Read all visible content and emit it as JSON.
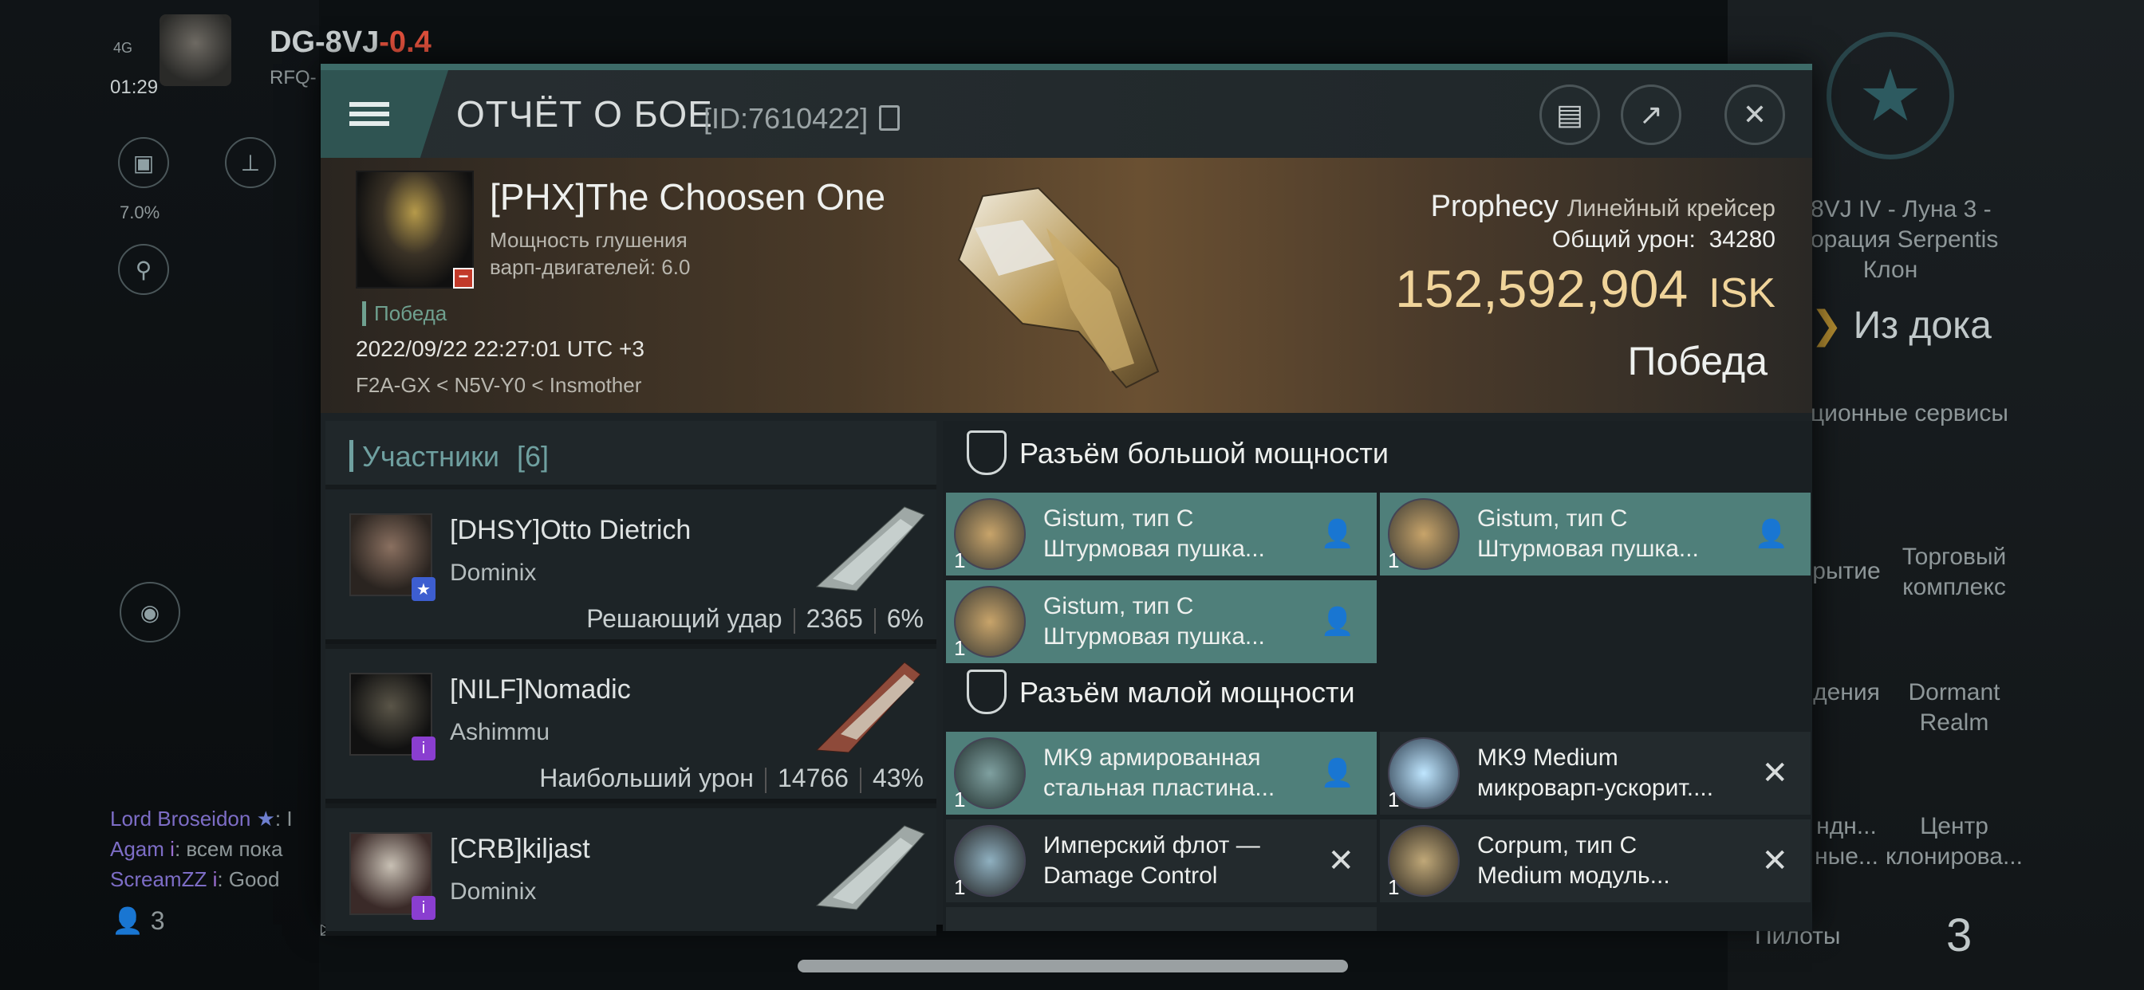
{
  "hud": {
    "signal": "4G",
    "clock": "01:29",
    "system_name": "DG-8VJ",
    "system_security": "-0.4",
    "region_prefix": "RFQ-",
    "cargo_percent": "7.0%"
  },
  "chat": [
    {
      "name": "Lord Broseidon",
      "text": ": I"
    },
    {
      "name": "Agam",
      "text": ": всем пока"
    },
    {
      "name": "ScreamZZ",
      "text": ": Good"
    }
  ],
  "bottom_bar": {
    "pilots_count": "3"
  },
  "right_panel": {
    "station_line1": "8VJ IV - Луна 3 -",
    "station_line2": "орация Serpentis",
    "station_line3": "Клон",
    "undock_label": "Из дока",
    "services_label": "ционные сервисы",
    "tiles": [
      {
        "label": "рытие"
      },
      {
        "label": "Торговый комплекс"
      },
      {
        "label": "дения"
      },
      {
        "label": "Dormant Realm"
      },
      {
        "label": "ндн... ные..."
      },
      {
        "label": "Центр клонирова..."
      }
    ],
    "pilots_label": "Пилоты",
    "pilots_value": "3"
  },
  "dialog": {
    "title": "ОТЧЁТ О БОЕ",
    "report_id": "[ID:7610422]",
    "pilot": {
      "name": "[PHX]The Choosen One",
      "scram_line1": "Мощность глушения",
      "scram_line2": "варп-двигателей: 6.0",
      "outcome_tag": "Победа",
      "datetime": "2022/09/22 22:27:01 UTC +3",
      "route": "F2A-GX < N5V-Y0 < Insmother"
    },
    "ship": {
      "name": "Prophecy",
      "class": "Линейный крейсер",
      "total_damage_label": "Общий урон:",
      "total_damage": "34280",
      "isk_value": "152,592,904",
      "isk_unit": "ISK",
      "result": "Победа"
    },
    "participants": {
      "label": "Участники",
      "count": "[6]",
      "list": [
        {
          "name": "[DHSY]Otto Dietrich",
          "ship": "Dominix",
          "stat_label": "Решающий удар",
          "damage": "2365",
          "percent": "6%"
        },
        {
          "name": "[NILF]Nomadic",
          "ship": "Ashimmu",
          "stat_label": "Наибольший урон",
          "damage": "14766",
          "percent": "43%"
        },
        {
          "name": "[CRB]kiljast",
          "ship": "Dominix"
        }
      ]
    },
    "high_slots": {
      "label": "Разъём большой мощности",
      "items": [
        {
          "name": "Gistum, тип C",
          "type": "Штурмовая пушка...",
          "qty": "1"
        },
        {
          "name": "Gistum, тип C",
          "type": "Штурмовая пушка...",
          "qty": "1"
        },
        {
          "name": "Gistum, тип C",
          "type": "Штурмовая пушка...",
          "qty": "1"
        }
      ]
    },
    "low_slots": {
      "label": "Разъём малой мощности",
      "items": [
        {
          "name": "MK9 армированная",
          "type": "стальная пластина...",
          "qty": "1"
        },
        {
          "name": "MK9 Medium",
          "type": "микроварп-ускорит....",
          "qty": "1"
        },
        {
          "name": "Имперский флот —",
          "type": "Damage Control",
          "qty": "1"
        },
        {
          "name": "Corpum, тип C",
          "type": "Medium модуль...",
          "qty": "1"
        }
      ]
    }
  }
}
